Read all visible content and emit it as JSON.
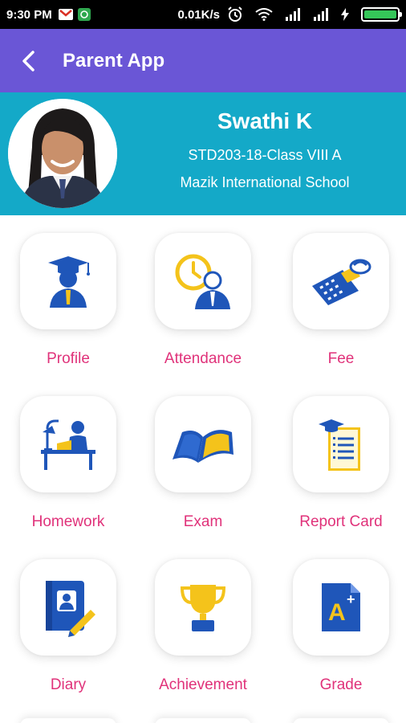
{
  "statusbar": {
    "time": "9:30 PM",
    "speed": "0.01K/s",
    "icons": [
      "gmail-icon",
      "chat-icon",
      "alarm-icon",
      "wifi-icon",
      "signal-icon",
      "signal-icon",
      "charging-icon",
      "battery-icon"
    ],
    "battery_level": 1.0,
    "battery_color": "#35c759"
  },
  "appbar": {
    "title": "Parent App",
    "color": "#6a56d6"
  },
  "student": {
    "name": "Swathi K",
    "id_class": "STD203-18-Class VIII A",
    "school": "Mazik International School",
    "header_color": "#14a9c8"
  },
  "menu": [
    {
      "label": "Profile",
      "icon": "graduate-icon"
    },
    {
      "label": "Attendance",
      "icon": "clock-person-icon"
    },
    {
      "label": "Fee",
      "icon": "calculator-money-icon"
    },
    {
      "label": "Homework",
      "icon": "study-desk-icon"
    },
    {
      "label": "Exam",
      "icon": "open-book-icon"
    },
    {
      "label": "Report Card",
      "icon": "report-card-icon"
    },
    {
      "label": "Diary",
      "icon": "diary-pencil-icon"
    },
    {
      "label": "Achievement",
      "icon": "trophy-icon"
    },
    {
      "label": "Grade",
      "icon": "grade-a-plus-icon"
    }
  ],
  "colors": {
    "label": "#e0327a",
    "icon_blue": "#1f56b9",
    "icon_yellow": "#f4c31b"
  }
}
